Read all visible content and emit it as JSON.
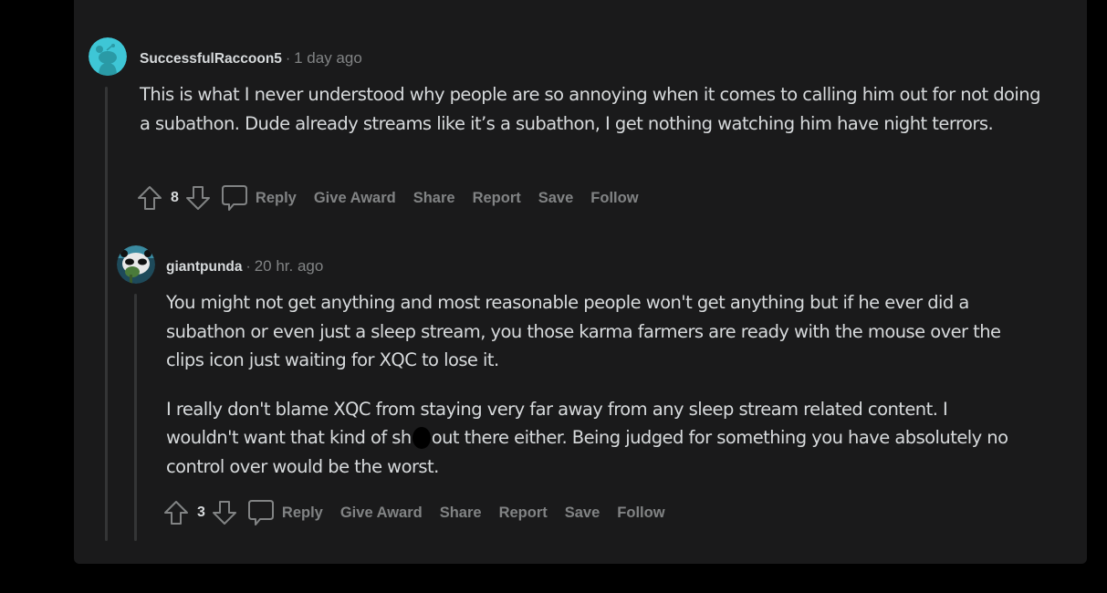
{
  "comments": [
    {
      "username": "SuccessfulRaccoon5",
      "separator": "·",
      "time": "1 day ago",
      "avatar_icon": "reddit-snoo-avatar-icon",
      "avatar_color": "#3ec6d6",
      "paragraphs": [
        "This is what I never understood why people are so annoying when it comes to calling him out for not doing a subathon. Dude already streams like it’s a subathon, I get nothing watching him have night terrors."
      ],
      "score": "8",
      "actions": {
        "reply": "Reply",
        "give_award": "Give Award",
        "share": "Share",
        "report": "Report",
        "save": "Save",
        "follow": "Follow"
      }
    },
    {
      "username": "giantpunda",
      "separator": "·",
      "time": "20 hr. ago",
      "avatar_icon": "panda-avatar-icon",
      "paragraphs": [
        "You might not get anything and most reasonable people won't get anything but if he ever did a subathon or even just a sleep stream, you those karma farmers are ready with the mouse over the clips icon just waiting for XQC to lose it.",
        {
          "before": "I really don't blame XQC from staying very far away from any sleep stream related content. I wouldn't want that kind of sh",
          "after": "out there either. Being judged for something you have absolutely no control over would be the worst."
        }
      ],
      "score": "3",
      "actions": {
        "reply": "Reply",
        "give_award": "Give Award",
        "share": "Share",
        "report": "Report",
        "save": "Save",
        "follow": "Follow"
      }
    }
  ],
  "colors": {
    "background": "#000000",
    "card": "#1a1a1b",
    "text": "#d7dadc",
    "muted": "#818384",
    "thread_line": "#343536"
  }
}
